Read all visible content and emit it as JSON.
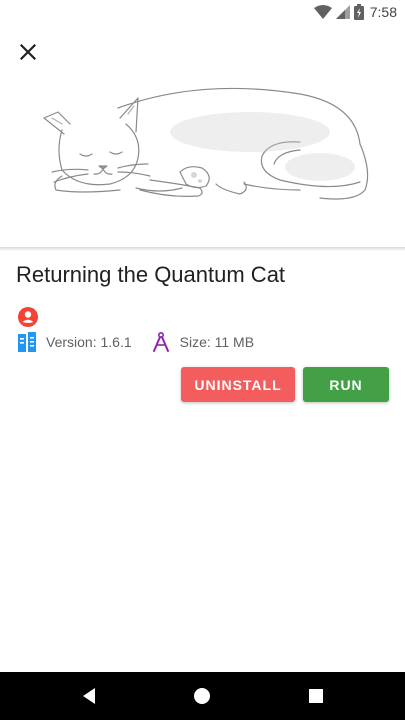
{
  "status_bar": {
    "time": "7:58"
  },
  "app": {
    "title": "Returning the Quantum Cat",
    "version_text": "Version: 1.6.1",
    "size_text": "Size: 11 MB"
  },
  "actions": {
    "uninstall_label": "UNINSTALL",
    "run_label": "RUN"
  },
  "colors": {
    "uninstall": "#f45d5d",
    "run": "#43a047",
    "author_icon": "#f44336",
    "version_icon": "#2196f3",
    "size_icon": "#8e24aa"
  },
  "icons": {
    "close": "close-icon",
    "author": "account-circle-icon",
    "version": "file-version-icon",
    "size": "compass-icon",
    "nav_back": "back-icon",
    "nav_home": "home-icon",
    "nav_recents": "recents-icon"
  }
}
